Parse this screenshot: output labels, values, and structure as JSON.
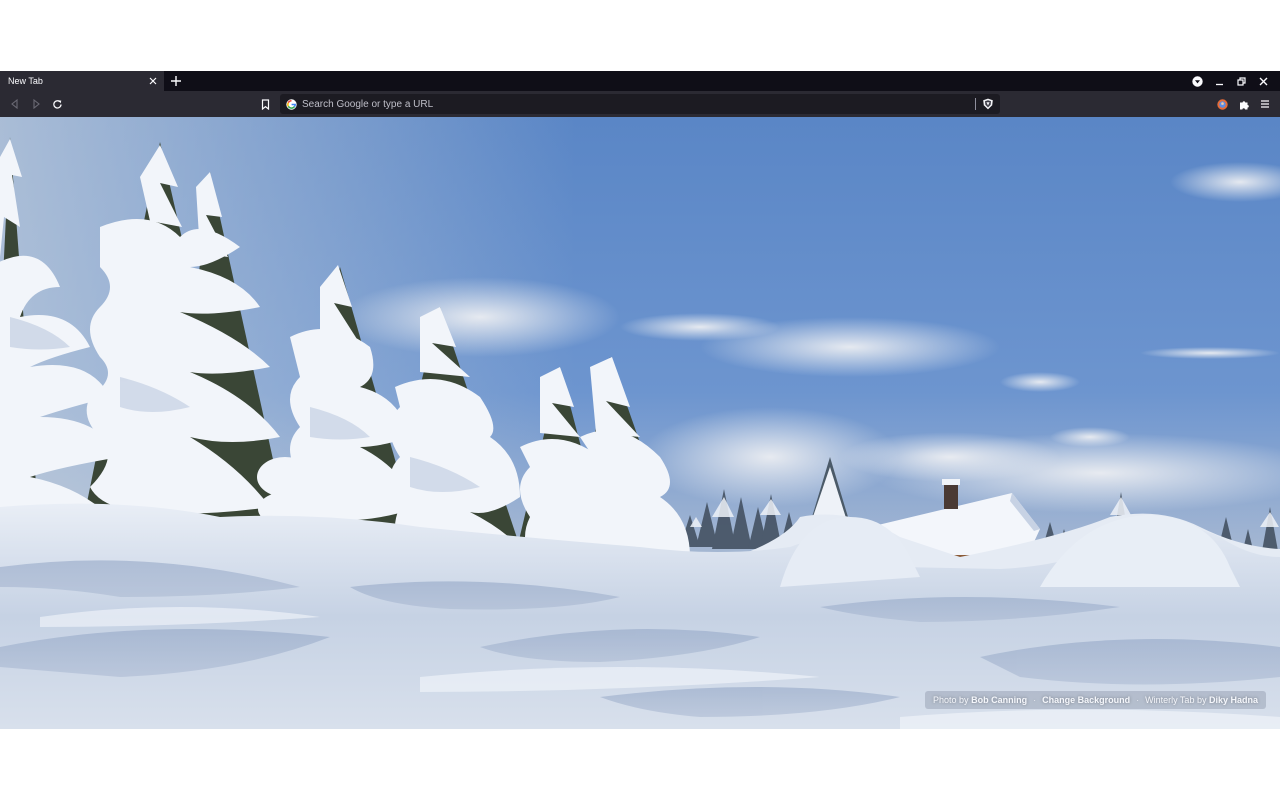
{
  "tabs": [
    {
      "title": "New Tab"
    }
  ],
  "urlbar": {
    "placeholder": "Search Google or type a URL",
    "value": ""
  },
  "icons": {
    "back": "back-arrow-icon",
    "forward": "forward-arrow-icon",
    "reload": "reload-icon",
    "bookmark": "bookmark-icon",
    "search_engine": "google-g-icon",
    "shield": "brave-shield-icon",
    "profile": "profile-avatar-icon",
    "extensions": "puzzle-piece-icon",
    "menu": "hamburger-menu-icon",
    "download": "download-indicator-icon",
    "minimize": "minimize-icon",
    "maximize": "restore-icon",
    "close": "close-icon",
    "new_tab": "plus-icon"
  },
  "credits": {
    "photo_prefix": "Photo by",
    "photographer": "Bob Canning",
    "separator": "·",
    "change_background": "Change Background",
    "theme_prefix": "Winterly Tab by",
    "theme_author": "Diky Hadna"
  },
  "colors": {
    "tabstrip_bg": "#0f0e17",
    "toolbar_bg": "#2b2a33",
    "urlbar_bg": "#1c1b22",
    "text": "#fbfbfe",
    "sky_top": "#4a7bc2",
    "snow": "#dfe6f1"
  }
}
